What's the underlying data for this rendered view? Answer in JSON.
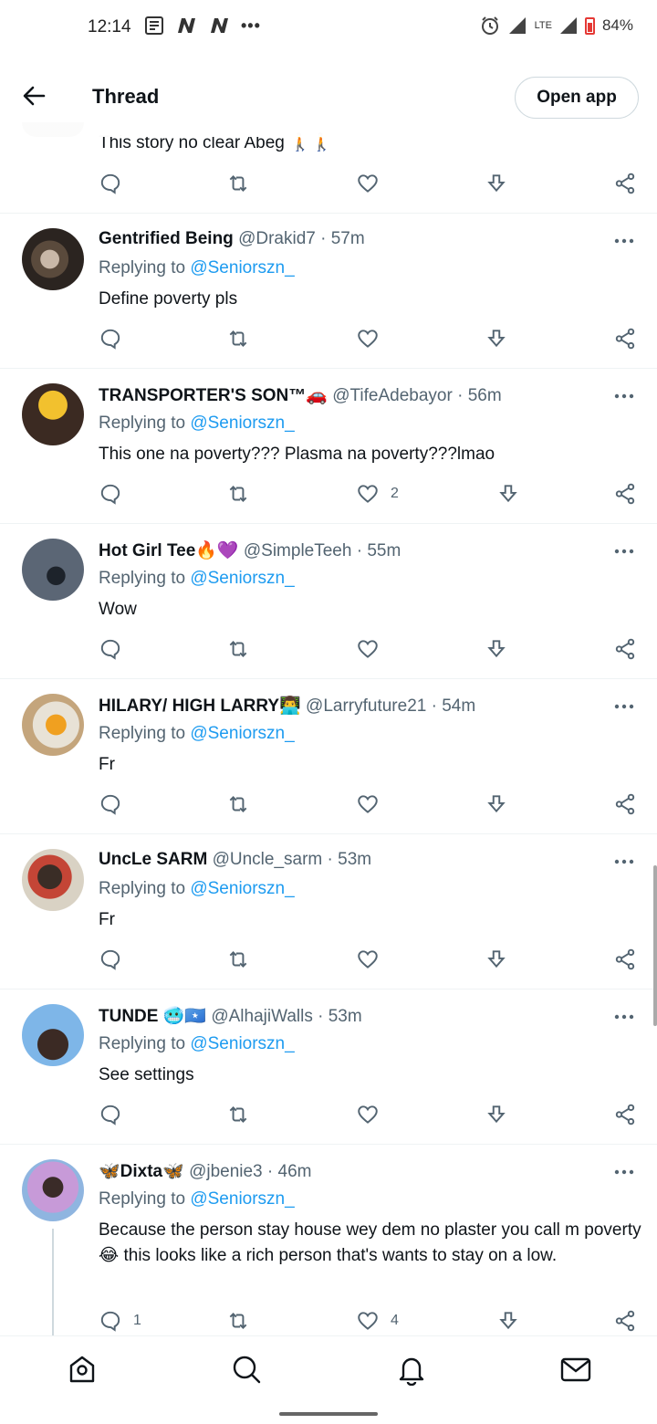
{
  "status": {
    "time": "12:14",
    "network": "LTE",
    "battery": "84%",
    "left_icons": [
      "news-icon",
      "n-icon",
      "n-icon"
    ],
    "more": "•••"
  },
  "header": {
    "title": "Thread",
    "open_app": "Open app"
  },
  "top_partial": {
    "text": "This story no clear Abeg 🚶🚶"
  },
  "tweets": [
    {
      "name": "Gentrified Being",
      "handle": "@Drakid7",
      "time": "57m",
      "replying": "Replying to",
      "mention": "@Seniorszn_",
      "text": "Define poverty pls",
      "replies": "",
      "retweets": "",
      "likes": ""
    },
    {
      "name": "TRANSPORTER'S SON™🚗",
      "handle": "@TifeAdebayor",
      "time": "56m",
      "replying": "Replying to",
      "mention": "@Seniorszn_",
      "text": "This one na poverty??? Plasma na poverty???lmao",
      "replies": "",
      "retweets": "",
      "likes": "2"
    },
    {
      "name": "Hot Girl Tee🔥💜",
      "handle": "@SimpleTeeh",
      "time": "55m",
      "replying": "Replying to",
      "mention": "@Seniorszn_",
      "text": "Wow",
      "replies": "",
      "retweets": "",
      "likes": ""
    },
    {
      "name": "HILARY/ HIGH LARRY👨‍💻",
      "handle": "@Larryfuture21",
      "time": "54m",
      "replying": "Replying to",
      "mention": "@Seniorszn_",
      "text": "Fr",
      "replies": "",
      "retweets": "",
      "likes": ""
    },
    {
      "name": "UncLe SARM",
      "handle": "@Uncle_sarm",
      "time": "53m",
      "replying": "Replying to",
      "mention": "@Seniorszn_",
      "text": "Fr",
      "replies": "",
      "retweets": "",
      "likes": ""
    },
    {
      "name": "TUNDE 🥶🇸🇴",
      "handle": "@AlhajiWalls",
      "time": "53m",
      "replying": "Replying to",
      "mention": "@Seniorszn_",
      "text": "See settings",
      "replies": "",
      "retweets": "",
      "likes": ""
    },
    {
      "name": "🦋Dixta🦋",
      "handle": "@jbenie3",
      "time": "46m",
      "replying": "Replying to",
      "mention": "@Seniorszn_",
      "text": "Because the person stay house wey dem no plaster you call m poverty😂 this looks like a rich person that's wants to stay on a low.",
      "replies": "1",
      "retweets": "",
      "likes": "4"
    }
  ],
  "bottom_nav": [
    "home-icon",
    "search-icon",
    "notifications-icon",
    "messages-icon"
  ],
  "colors": {
    "accent": "#1d9bf0",
    "secondary_text": "#536471",
    "primary_text": "#0f1419",
    "divider": "#eff3f4"
  }
}
